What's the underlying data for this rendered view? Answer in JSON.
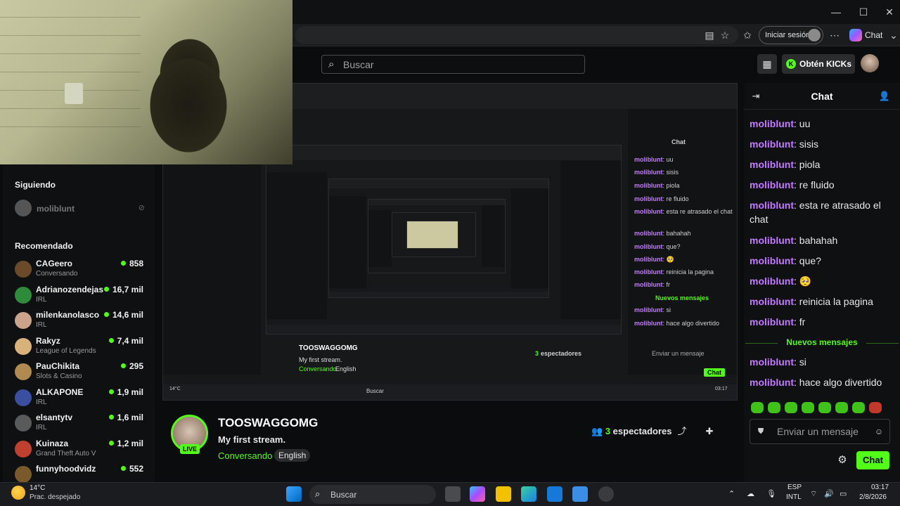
{
  "browser": {
    "signin_label": "Iniciar sesión",
    "copilot_label": "Chat"
  },
  "header": {
    "search_placeholder": "Buscar",
    "kicks_label": "Obtén KICKs"
  },
  "sidebar": {
    "following_title": "Siguiendo",
    "following": [
      {
        "name": "moliblunt"
      }
    ],
    "recommended_title": "Recomendado",
    "recommended": [
      {
        "name": "CAGeero",
        "category": "Conversando",
        "viewers": "858",
        "avatar_color": "#6b4a2a"
      },
      {
        "name": "Adrianozendejas",
        "category": "IRL",
        "viewers": "16,7 mil",
        "avatar_color": "#2e8b3a"
      },
      {
        "name": "milenkanolasco",
        "category": "IRL",
        "viewers": "14,6 mil",
        "avatar_color": "#c9a48a"
      },
      {
        "name": "Rakyz",
        "category": "League of Legends",
        "viewers": "7,4 mil",
        "avatar_color": "#d8b27a"
      },
      {
        "name": "PauChikita",
        "category": "Slots & Casino",
        "viewers": "295",
        "avatar_color": "#b08a50"
      },
      {
        "name": "ALKAPONE",
        "category": "IRL",
        "viewers": "1,9 mil",
        "avatar_color": "#3a4fa0"
      },
      {
        "name": "elsantytv",
        "category": "IRL",
        "viewers": "1,6 mil",
        "avatar_color": "#5a5a5a"
      },
      {
        "name": "Kuinaza",
        "category": "Grand Theft Auto V",
        "viewers": "1,2 mil",
        "avatar_color": "#c04030"
      },
      {
        "name": "funnyhoodvidz",
        "category": "",
        "viewers": "552",
        "avatar_color": "#7a5a2a"
      }
    ]
  },
  "stream": {
    "channel_name": "TOOSWAGGOMG",
    "title": "My first stream.",
    "category": "Conversando",
    "language": "English",
    "live_badge": "LIVE",
    "viewers_count": "3",
    "viewers_label": "espectadores"
  },
  "chat": {
    "title": "Chat",
    "messages": [
      {
        "user": "moliblunt",
        "text": "uu"
      },
      {
        "user": "moliblunt",
        "text": "sisis"
      },
      {
        "user": "moliblunt",
        "text": "piola"
      },
      {
        "user": "moliblunt",
        "text": "re fluido"
      },
      {
        "user": "moliblunt",
        "text": "esta re atrasado el chat"
      },
      {
        "user": "moliblunt",
        "text": "bahahah"
      },
      {
        "user": "moliblunt",
        "text": "que?"
      },
      {
        "user": "moliblunt",
        "text": "🥺"
      },
      {
        "user": "moliblunt",
        "text": "reinicia la pagina"
      },
      {
        "user": "moliblunt",
        "text": "fr"
      }
    ],
    "new_messages_label": "Nuevos mensajes",
    "new_messages": [
      {
        "user": "moliblunt",
        "text": "si"
      },
      {
        "user": "moliblunt",
        "text": "hace algo divertido"
      }
    ],
    "input_placeholder": "Enviar un mensaje",
    "send_label": "Chat"
  },
  "taskbar": {
    "temperature": "14°C",
    "weather": "Prac. despejado",
    "search_label": "Buscar",
    "lang_line1": "ESP",
    "lang_line2": "INTL",
    "time": "03:17",
    "date": "2/8/2026"
  },
  "colors": {
    "accent": "#53fc18",
    "username": "#c37bff",
    "background": "#0b0c0d"
  }
}
